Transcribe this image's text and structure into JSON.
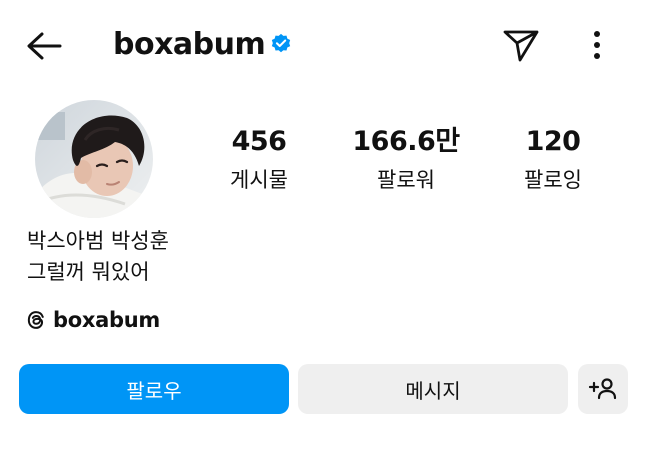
{
  "header": {
    "username": "boxabum",
    "verified": true,
    "icons": [
      "back-arrow-icon",
      "verified-badge-icon",
      "send-icon",
      "more-vertical-icon"
    ]
  },
  "profile": {
    "stats": [
      {
        "value": "456",
        "label": "게시물"
      },
      {
        "value": "166.6만",
        "label": "팔로워"
      },
      {
        "value": "120",
        "label": "팔로잉"
      }
    ],
    "bio_name": "박스아범 박성훈",
    "bio_text": "그럴꺼 뭐있어",
    "threads_handle": "boxabum"
  },
  "actions": {
    "follow_label": "팔로우",
    "message_label": "메시지"
  },
  "colors": {
    "accent": "#0095f6",
    "secondary_button": "#efefef",
    "verified_badge": "#0095f6"
  }
}
